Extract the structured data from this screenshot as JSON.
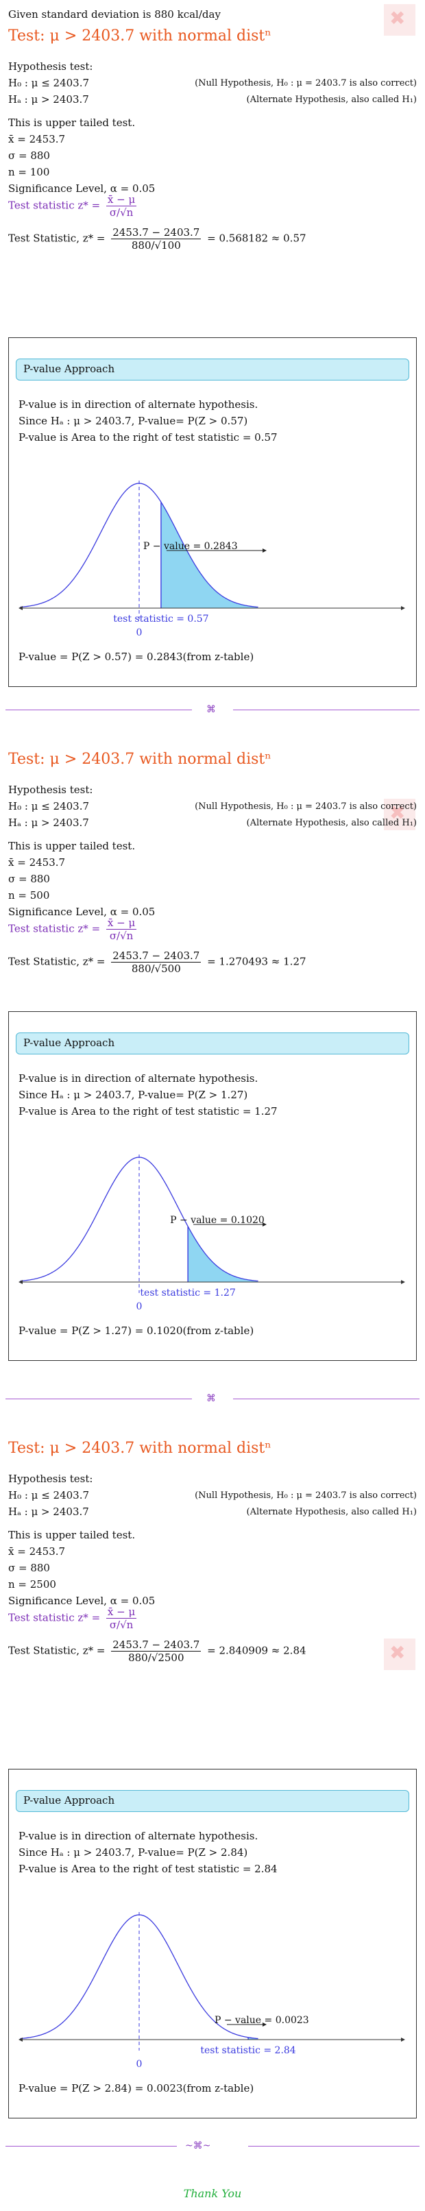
{
  "intro": "Given standard deviation is 880 kcal/day",
  "sections": [
    {
      "title": "Test: μ > 2403.7 with normal distⁿ",
      "hyp_label": "Hypothesis test:",
      "h0": "H₀ : μ ≤ 2403.7",
      "h0_note": "(Null Hypothesis, H₀ : μ = 2403.7 is also correct)",
      "ha": "Hₐ : μ > 2403.7",
      "ha_note": "(Alternate Hypothesis, also called H₁)",
      "tail": "This is upper tailed test.",
      "xbar": "x̄ = 2453.7",
      "sigma": "σ = 880",
      "n": "n = 100",
      "alpha": "Significance Level, α = 0.05",
      "ts_formula_label": "Test statistic z* =",
      "ts_formula_num": "x̄ − μ",
      "ts_formula_den": "σ/√n",
      "ts_label": "Test Statistic, z* =",
      "ts_num": "2453.7 − 2403.7",
      "ts_den": "880/√100",
      "ts_result": "= 0.568182 ≈ 0.57",
      "pv_header": "P-value Approach",
      "pv_line1": "P-value is in direction of alternate hypothesis.",
      "pv_line2": "Since Hₐ : μ > 2403.7, P-value= P(Z > 0.57)",
      "pv_line3": "P-value is Area to the right of test statistic = 0.57",
      "graph_pvalue": "P − value = 0.2843",
      "graph_ts": "test statistic = 0.57",
      "graph_zero": "0",
      "z": 0.57,
      "pv_final": "P-value = P(Z > 0.57) = 0.2843(from z-table)"
    },
    {
      "title": "Test: μ > 2403.7 with normal distⁿ",
      "hyp_label": "Hypothesis test:",
      "h0": "H₀ : μ ≤ 2403.7",
      "h0_note": "(Null Hypothesis, H₀ : μ = 2403.7 is also correct)",
      "ha": "Hₐ : μ > 2403.7",
      "ha_note": "(Alternate Hypothesis, also called H₁)",
      "tail": "This is upper tailed test.",
      "xbar": "x̄ = 2453.7",
      "sigma": "σ = 880",
      "n": "n = 500",
      "alpha": "Significance Level, α = 0.05",
      "ts_formula_label": "Test statistic z* =",
      "ts_formula_num": "x̄ − μ",
      "ts_formula_den": "σ/√n",
      "ts_label": "Test Statistic, z* =",
      "ts_num": "2453.7 − 2403.7",
      "ts_den": "880/√500",
      "ts_result": "= 1.270493 ≈ 1.27",
      "pv_header": "P-value Approach",
      "pv_line1": "P-value is in direction of alternate hypothesis.",
      "pv_line2": "Since Hₐ : μ > 2403.7, P-value= P(Z > 1.27)",
      "pv_line3": "P-value is Area to the right of test statistic = 1.27",
      "graph_pvalue": "P − value = 0.1020",
      "graph_ts": "test statistic = 1.27",
      "graph_zero": "0",
      "z": 1.27,
      "pv_final": "P-value = P(Z > 1.27) = 0.1020(from z-table)"
    },
    {
      "title": "Test: μ > 2403.7 with normal distⁿ",
      "hyp_label": "Hypothesis test:",
      "h0": "H₀ : μ ≤ 2403.7",
      "h0_note": "(Null Hypothesis, H₀ : μ = 2403.7 is also correct)",
      "ha": "Hₐ : μ > 2403.7",
      "ha_note": "(Alternate Hypothesis, also called H₁)",
      "tail": "This is upper tailed test.",
      "xbar": "x̄ = 2453.7",
      "sigma": "σ = 880",
      "n": "n = 2500",
      "alpha": "Significance Level, α = 0.05",
      "ts_formula_label": "Test statistic z* =",
      "ts_formula_num": "x̄ − μ",
      "ts_formula_den": "σ/√n",
      "ts_label": "Test Statistic, z* =",
      "ts_num": "2453.7 − 2403.7",
      "ts_den": "880/√2500",
      "ts_result": "= 2.840909 ≈ 2.84",
      "pv_header": "P-value Approach",
      "pv_line1": "P-value is in direction of alternate hypothesis.",
      "pv_line2": "Since Hₐ : μ > 2403.7, P-value= P(Z > 2.84)",
      "pv_line3": "P-value is Area to the right of test statistic = 2.84",
      "graph_pvalue": "P − value = 0.0023",
      "graph_ts": "test statistic = 2.84",
      "graph_zero": "0",
      "z": 2.84,
      "pv_final": "P-value = P(Z > 2.84) = 0.0023(from z-table)"
    }
  ],
  "thanks": "Thank You",
  "colors": {
    "title": "#e8571e",
    "curve": "#3a3adf",
    "fill": "#8fd6f2",
    "purple": "#7a2bb5",
    "thanks": "#1fae3a"
  }
}
